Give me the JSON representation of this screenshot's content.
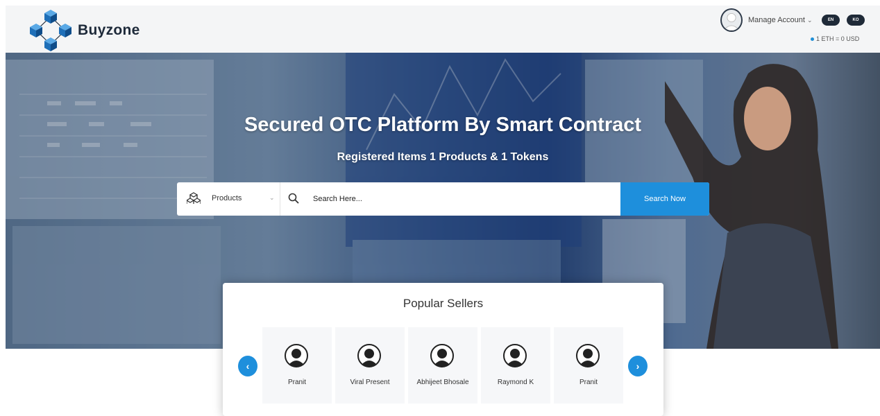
{
  "header": {
    "brand": "Buyzone",
    "logo_icon": "cube-network-icon",
    "account": {
      "manage_label": "Manage Account",
      "lang_en": "EN",
      "lang_ko": "KO",
      "rate": "1 ETH = 0 USD"
    }
  },
  "hero": {
    "title": "Secured OTC Platform By Smart Contract",
    "subtitle": "Registered Items 1 Products & 1 Tokens"
  },
  "search": {
    "category": "Products",
    "placeholder": "Search Here...",
    "button_label": "Search Now"
  },
  "sellers": {
    "title": "Popular Sellers",
    "prev_icon": "‹",
    "next_icon": "›",
    "items": [
      {
        "name": "Pranit"
      },
      {
        "name": "Viral Present"
      },
      {
        "name": "Abhijeet Bhosale"
      },
      {
        "name": "Raymond K"
      },
      {
        "name": "Pranit"
      }
    ]
  },
  "colors": {
    "accent": "#1e8fdc",
    "dark": "#1f2a38"
  }
}
